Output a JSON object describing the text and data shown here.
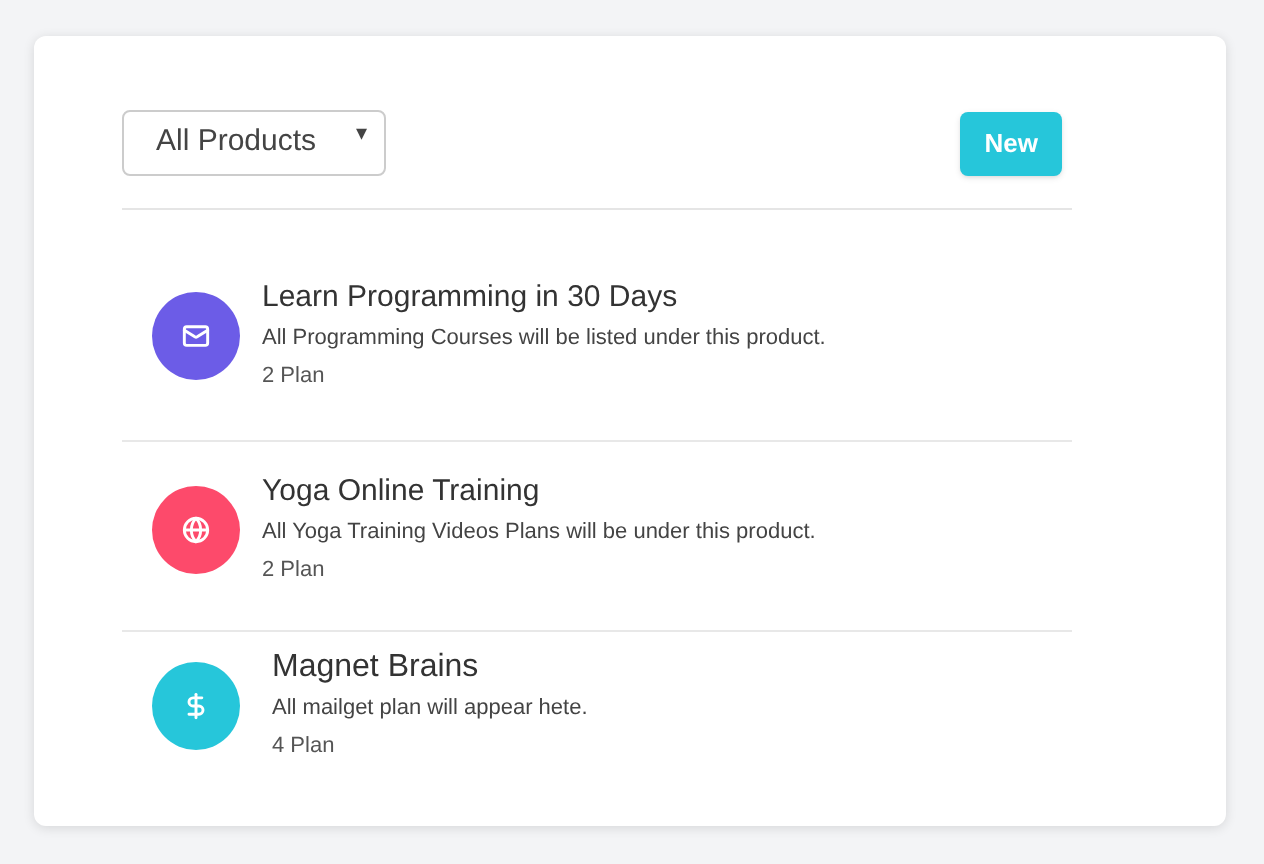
{
  "filter": {
    "value": "All Products",
    "arrow": "▾"
  },
  "new_button": "New",
  "products": [
    {
      "title": "Learn Programming in 30 Days",
      "description": "All Programming Courses will be listed under this product.",
      "plans": "2 Plan",
      "kind": "mail",
      "color": "#6c5ce7"
    },
    {
      "title": "Yoga Online Training",
      "description": "All Yoga Training Videos Plans will be under this product.",
      "plans": "2 Plan",
      "kind": "globe",
      "color": "#fd4a6b"
    },
    {
      "title": "Magnet Brains",
      "description": "All mailget plan will appear hete.",
      "plans": "4 Plan",
      "kind": "dollar",
      "color": "#26c6da"
    }
  ]
}
